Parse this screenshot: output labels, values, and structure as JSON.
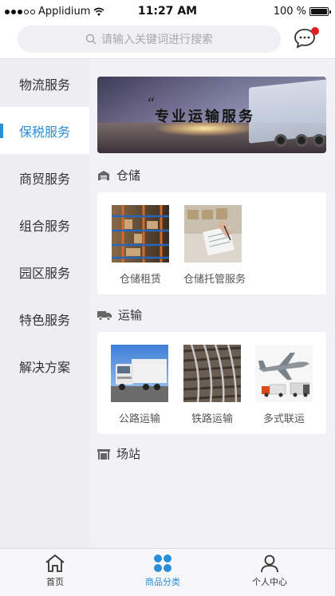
{
  "status_bar": {
    "carrier": "Applidium",
    "time": "11:27 AM",
    "battery": "100 %",
    "battery_level": 1.0
  },
  "search": {
    "placeholder": "请输入关键词进行搜索"
  },
  "sidebar": {
    "items": [
      {
        "label": "物流服务",
        "active": false
      },
      {
        "label": "保税服务",
        "active": true
      },
      {
        "label": "商贸服务",
        "active": false
      },
      {
        "label": "组合服务",
        "active": false
      },
      {
        "label": "园区服务",
        "active": false
      },
      {
        "label": "特色服务",
        "active": false
      },
      {
        "label": "解决方案",
        "active": false
      }
    ]
  },
  "banner": {
    "quote_mark": "“",
    "text": "专业运输服务"
  },
  "sections": {
    "storage": {
      "title": "仓储",
      "items": [
        {
          "label": "仓储租赁"
        },
        {
          "label": "仓储托管服务"
        }
      ]
    },
    "transport": {
      "title": "运输",
      "items": [
        {
          "label": "公路运输"
        },
        {
          "label": "铁路运输"
        },
        {
          "label": "多式联运"
        }
      ]
    },
    "station": {
      "title": "场站"
    }
  },
  "tabbar": {
    "home": "首页",
    "category": "商品分类",
    "profile": "个人中心"
  },
  "colors": {
    "accent": "#2a8fd8",
    "badge": "#e02020"
  }
}
